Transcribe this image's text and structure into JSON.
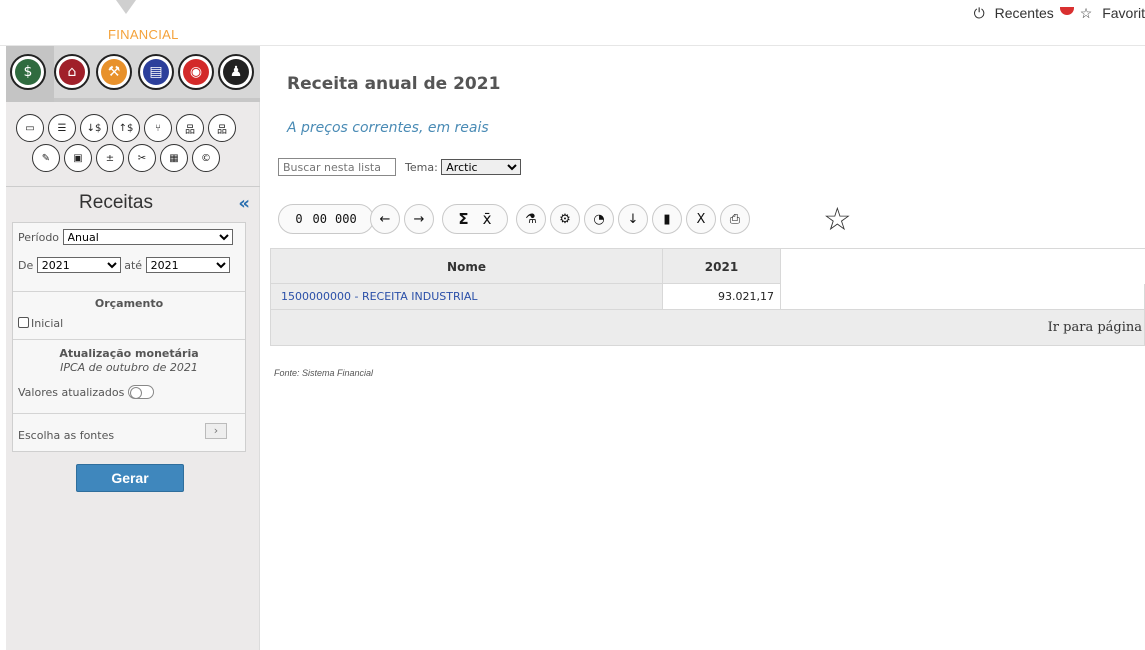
{
  "brand": {
    "logo_text": "FINANCIAL"
  },
  "top": {
    "recentes": "Recentes",
    "favoritos": "Favorit"
  },
  "sidebar": {
    "title": "Receitas",
    "periodo_label": "Período",
    "periodo_value": "Anual",
    "de_label": "De",
    "de_value": "2021",
    "ate_label": "até",
    "ate_value": "2021",
    "orcamento_title": "Orçamento",
    "inicial_label": "Inicial",
    "atualizacao_title": "Atualização monetária",
    "atualizacao_sub": "IPCA de outubro de 2021",
    "valores_label": "Valores atualizados",
    "fontes_label": "Escolha as fontes",
    "gerar_label": "Gerar"
  },
  "main": {
    "title": "Receita anual de 2021",
    "subtitle": "A preços correntes, em reais",
    "search_placeholder": "Buscar nesta lista",
    "tema_label": "Tema:",
    "tema_value": "Arctic",
    "toolbar": {
      "zero": "0",
      "double_zero": "00",
      "triple_zero": "000"
    },
    "table": {
      "headers": [
        "Nome",
        "2021"
      ],
      "rows": [
        {
          "nome": "1500000000 - RECEITA INDUSTRIAL",
          "valor": "93.021,17"
        }
      ],
      "footer": "Ir para página"
    },
    "fonte": "Fonte: Sistema Financial"
  }
}
